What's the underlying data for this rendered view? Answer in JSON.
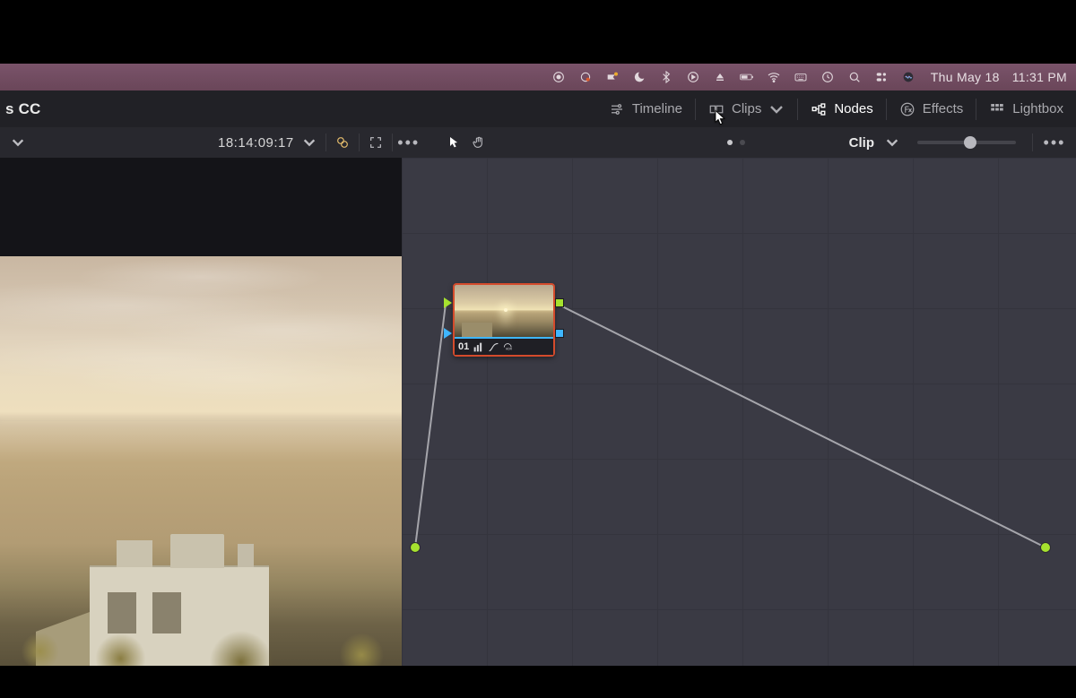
{
  "menubar": {
    "date": "Thu May 18",
    "time": "11:31 PM"
  },
  "project": {
    "title_suffix": "s CC"
  },
  "tabs": {
    "timeline": "Timeline",
    "clips": "Clips",
    "nodes": "Nodes",
    "effects": "Effects",
    "lightbox": "Lightbox"
  },
  "toolbar": {
    "timecode": "18:14:09:17",
    "clip_label": "Clip"
  },
  "node": {
    "number": "01",
    "hdr": "HDR"
  }
}
